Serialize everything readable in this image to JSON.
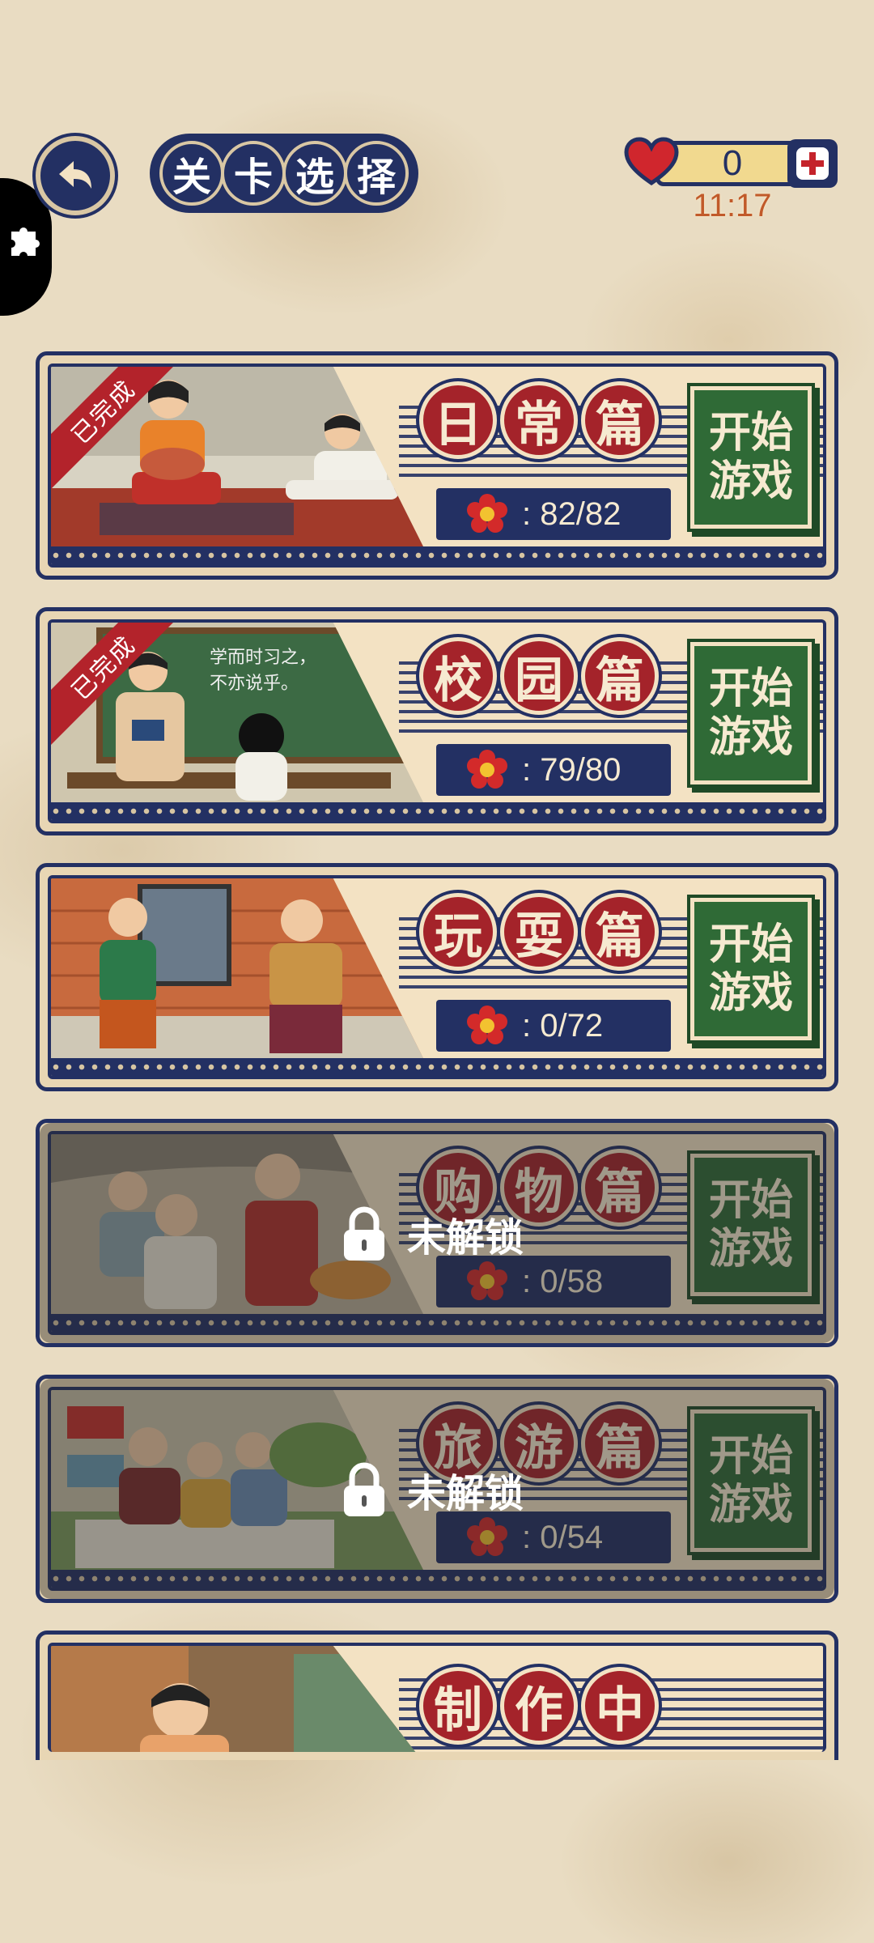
{
  "header": {
    "title_chars": [
      "关",
      "卡",
      "选",
      "择"
    ],
    "lives": "0",
    "timer": "11:17"
  },
  "icons": {
    "back": "back-arrow-icon",
    "side": "puzzle-icon",
    "lives": "heart-icon",
    "add": "plus-icon",
    "progress": "flower-icon",
    "lock": "lock-icon"
  },
  "colors": {
    "navy": "#233063",
    "red": "#a4232a",
    "green": "#2f6a36",
    "cream": "#f3e2c3"
  },
  "levels": [
    {
      "name_chars": [
        "日",
        "常",
        "篇"
      ],
      "progress": ": 82/82",
      "start_label": "开始游戏",
      "done_label": "已完成",
      "completed": true,
      "locked": false
    },
    {
      "name_chars": [
        "校",
        "园",
        "篇"
      ],
      "progress": ": 79/80",
      "start_label": "开始游戏",
      "done_label": "已完成",
      "completed": true,
      "locked": false,
      "chalkboard": "学而时习之，\n不亦说乎。"
    },
    {
      "name_chars": [
        "玩",
        "耍",
        "篇"
      ],
      "progress": ": 0/72",
      "start_label": "开始游戏",
      "completed": false,
      "locked": false
    },
    {
      "name_chars": [
        "购",
        "物",
        "篇"
      ],
      "progress": ": 0/58",
      "start_label": "开始游戏",
      "completed": false,
      "locked": true,
      "lock_label": "未解锁"
    },
    {
      "name_chars": [
        "旅",
        "游",
        "篇"
      ],
      "progress": ": 0/54",
      "start_label": "开始游戏",
      "completed": false,
      "locked": true,
      "lock_label": "未解锁"
    },
    {
      "name_chars": [
        "制",
        "作",
        "中"
      ],
      "completed": false,
      "locked": false
    }
  ]
}
